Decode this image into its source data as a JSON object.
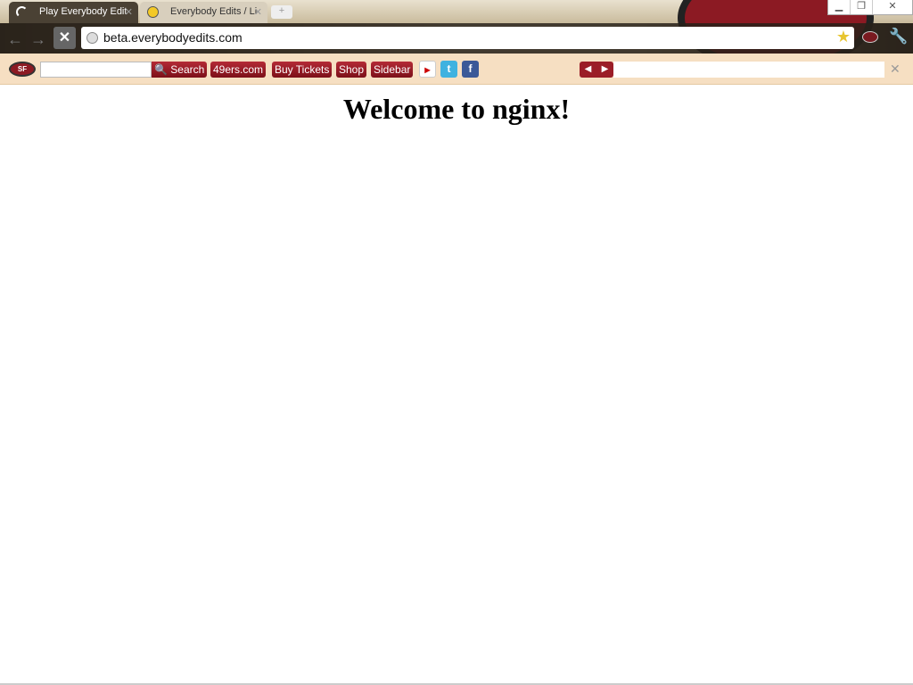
{
  "tabs": [
    {
      "title": "Play Everybody Edit",
      "active": true,
      "icon": "loading-spinner-icon"
    },
    {
      "title": "Everybody Edits / Li",
      "active": false,
      "icon": "sunglasses-smiley-icon"
    }
  ],
  "address": "beta.everybodyedits.com",
  "addon_bar": {
    "search_label": "Search",
    "search_value": "",
    "links": [
      "49ers.com",
      "Buy Tickets",
      "Shop",
      "Sidebar"
    ],
    "social": [
      "youtube",
      "twitter",
      "facebook"
    ],
    "logo_text": "SF"
  },
  "page": {
    "heading": "Welcome to nginx!"
  },
  "colors": {
    "accent": "#9b1d27",
    "addon_bg": "#f6dfc2"
  }
}
